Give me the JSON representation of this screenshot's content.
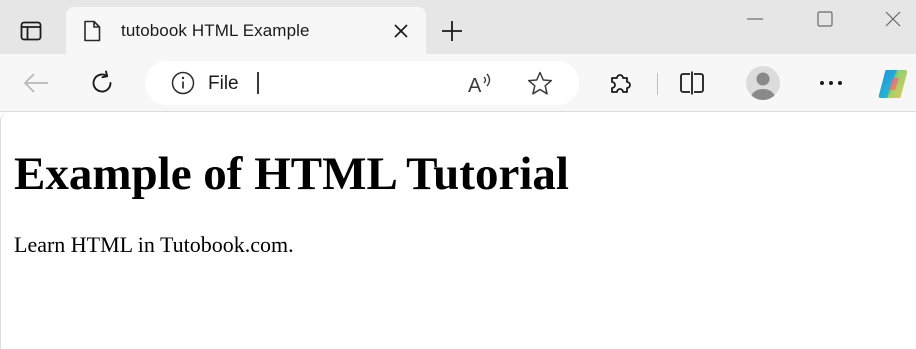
{
  "browser": {
    "tab": {
      "title": "tutobook HTML Example"
    },
    "address_bar": {
      "scheme_label": "File"
    },
    "icons": {
      "tab_actions": "tab-actions-icon",
      "favicon": "document-icon",
      "tab_close": "close-icon",
      "new_tab": "plus-icon",
      "minimize": "minimize-icon",
      "maximize": "maximize-icon",
      "window_close": "close-icon",
      "back": "back-arrow-icon",
      "refresh": "refresh-icon",
      "site_info": "info-icon",
      "read_aloud": "read-aloud-icon",
      "favorite": "star-icon",
      "extensions": "puzzle-icon",
      "split_screen": "split-screen-icon",
      "profile": "avatar-icon",
      "more": "more-icon",
      "copilot": "copilot-icon"
    },
    "colors": {
      "titlebar": "#e6e6e6",
      "toolbar": "#f7f7f7",
      "addressbar": "#ffffff"
    }
  },
  "page": {
    "heading": "Example of HTML Tutorial",
    "paragraph": "Learn HTML in Tutobook.com."
  }
}
